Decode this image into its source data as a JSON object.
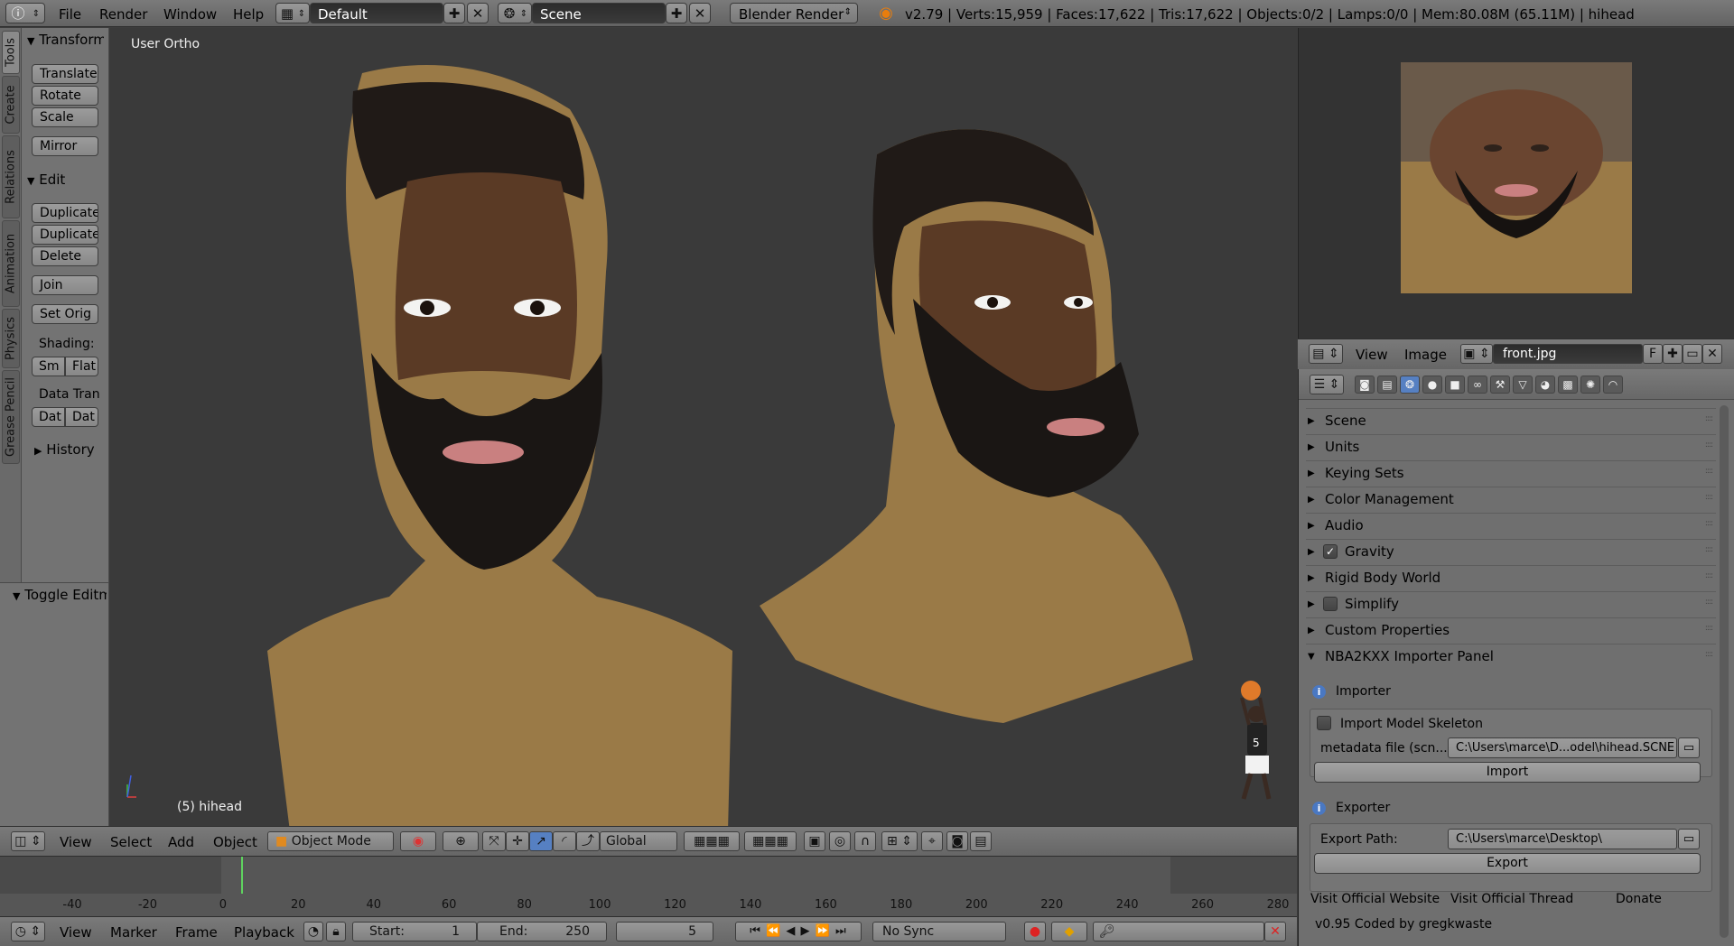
{
  "topbar": {
    "menus": [
      "File",
      "Render",
      "Window",
      "Help"
    ],
    "layout": "Default",
    "scene": "Scene",
    "engine": "Blender Render",
    "stats": "v2.79 | Verts:15,959 | Faces:17,622 | Tris:17,622 | Objects:0/2 | Lamps:0/0 | Mem:80.08M (65.11M) | hihead"
  },
  "tabs": [
    "Tools",
    "Create",
    "Relations",
    "Animation",
    "Physics",
    "Grease Pencil"
  ],
  "toolshelf": {
    "transform_header": "Transform",
    "transform_buttons": [
      "Translate",
      "Rotate",
      "Scale"
    ],
    "mirror": "Mirror",
    "edit_header": "Edit",
    "edit_buttons": [
      "Duplicate",
      "Duplicate",
      "Delete"
    ],
    "join": "Join",
    "set_origin": "Set Orig",
    "shading_label": "Shading:",
    "shading_smooth": "Sm",
    "shading_flat": "Flat",
    "data_transfer_label": "Data Tran",
    "data_a": "Dat",
    "data_b": "Dat",
    "history_header": "History",
    "lastop_header": "Toggle Editmode"
  },
  "viewport": {
    "title": "User Ortho",
    "object_label": "(5) hihead"
  },
  "viewport_header": {
    "menus": [
      "View",
      "Select",
      "Add",
      "Object"
    ],
    "mode": "Object Mode",
    "orientation": "Global"
  },
  "timeline": {
    "ticks": [
      "-40",
      "-20",
      "0",
      "20",
      "40",
      "60",
      "80",
      "100",
      "120",
      "140",
      "160",
      "180",
      "200",
      "220",
      "240",
      "260",
      "280"
    ],
    "current_frame": 5
  },
  "timeline_header": {
    "menus": [
      "View",
      "Marker",
      "Frame",
      "Playback"
    ],
    "start_label": "Start:",
    "start_value": "1",
    "end_label": "End:",
    "end_value": "250",
    "frame_value": "5",
    "sync": "No Sync"
  },
  "image_header": {
    "menus": [
      "View",
      "Image"
    ],
    "image_name": "front.jpg",
    "fake_user": "F"
  },
  "props": {
    "sections": [
      "Scene",
      "Units",
      "Keying Sets",
      "Color Management",
      "Audio",
      "Gravity",
      "Rigid Body World",
      "Simplify",
      "Custom Properties"
    ],
    "gravity_checked": true,
    "simplify_checked": false,
    "importer_panel_title": "NBA2KXX Importer Panel",
    "importer_label": "Importer",
    "import_skeleton_label": "Import Model Skeleton",
    "metadata_label": "metadata file (scn...",
    "metadata_path": "C:\\Users\\marce\\D...odel\\hihead.SCNE",
    "import_button": "Import",
    "exporter_label": "Exporter",
    "export_path_label": "Export Path:",
    "export_path": "C:\\Users\\marce\\Desktop\\",
    "export_button": "Export",
    "visit_website": "Visit Official Website",
    "visit_thread": "Visit Official Thread",
    "donate": "Donate",
    "version_credit": "v0.95 Coded by gregkwaste"
  },
  "colors": {
    "accent_blue": "#5680c2",
    "frame_line": "#5fd35f",
    "skin": "#9a7a47",
    "beard": "#1a1614"
  }
}
